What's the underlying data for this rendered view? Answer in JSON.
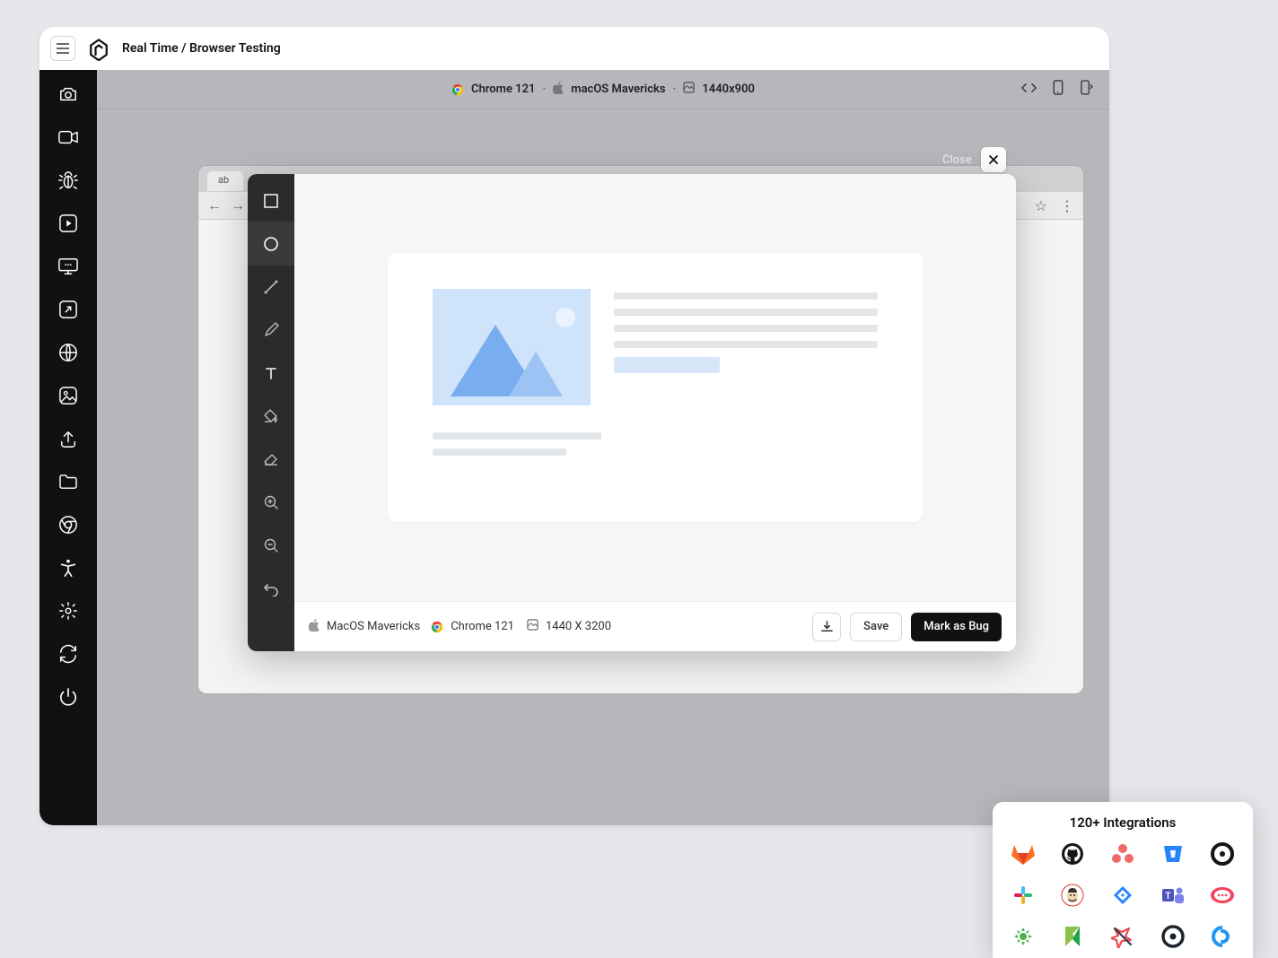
{
  "header": {
    "breadcrumb": "Real Time / Browser Testing"
  },
  "context": {
    "browser": "Chrome 121",
    "os": "macOS Mavericks",
    "resolution": "1440x900"
  },
  "left_rail": [
    "camera-icon",
    "video-icon",
    "bug-icon",
    "play-icon",
    "monitor-icon",
    "external-link-icon",
    "network-icon",
    "location-icon",
    "upload-icon",
    "folder-icon",
    "chrome-icon",
    "accessibility-icon",
    "settings-icon",
    "swap-icon",
    "power-icon"
  ],
  "browser": {
    "tab_label": "ab"
  },
  "modal": {
    "close_label": "Close",
    "annot_tools": [
      "rectangle",
      "circle",
      "line",
      "pencil",
      "text",
      "fill",
      "eraser",
      "zoom-in",
      "zoom-out",
      "undo"
    ],
    "footer": {
      "os": "MacOS Mavericks",
      "browser": "Chrome 121",
      "dimensions": "1440 X 3200",
      "save_label": "Save",
      "mark_bug_label": "Mark as Bug"
    }
  },
  "integrations": {
    "title": "120+ Integrations",
    "items": [
      "gitlab",
      "github",
      "asana",
      "bitbucket",
      "circleci",
      "slack",
      "jenkins",
      "jira",
      "teams",
      "rocketchat",
      "flower",
      "katalon",
      "xray",
      "newrelic",
      "clickup"
    ],
    "colors": {
      "gitlab": "#fc6d26",
      "github": "#181717",
      "asana": "#f06a6a",
      "bitbucket": "#2684ff",
      "circleci": "#161616",
      "slack": "#611f69",
      "jenkins": "#d33833",
      "jira": "#2684ff",
      "teams": "#6264a7",
      "rocketchat": "#f5455c",
      "flower": "#4caf50",
      "katalon": "#8bc34a",
      "xray": "#ec4e4e",
      "newrelic": "#1d252c",
      "clickup": "#2196f3"
    }
  }
}
